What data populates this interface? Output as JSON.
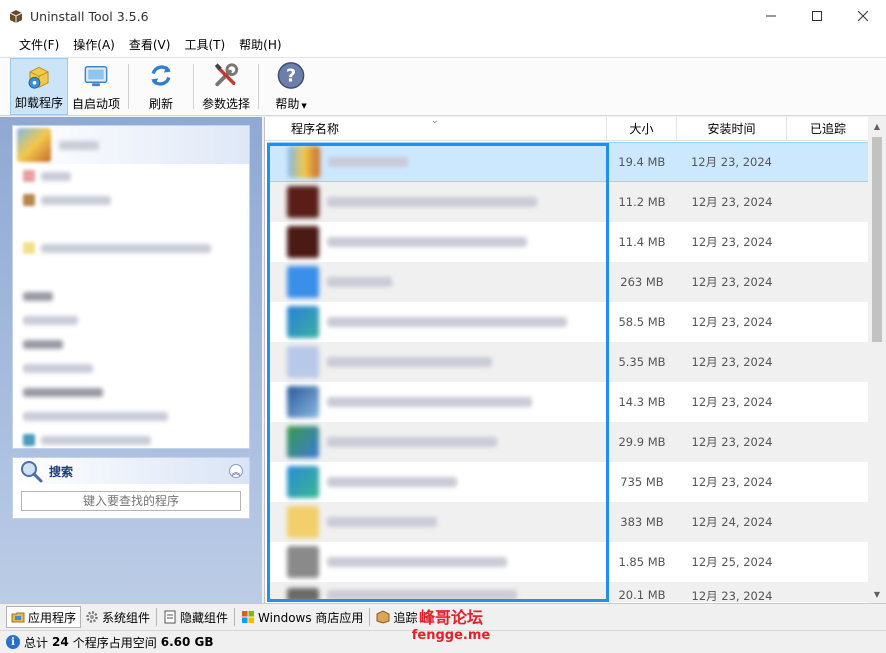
{
  "window": {
    "title": "Uninstall Tool 3.5.6"
  },
  "menu": [
    "文件(F)",
    "操作(A)",
    "查看(V)",
    "工具(T)",
    "帮助(H)"
  ],
  "toolbar": {
    "uninstall": "卸载程序",
    "autostart": "自启动项",
    "refresh": "刷新",
    "settings": "参数选择",
    "help": "帮助"
  },
  "search": {
    "title": "搜索",
    "placeholder": "键入要查找的程序"
  },
  "list": {
    "columns": {
      "name": "程序名称",
      "size": "大小",
      "date": "安装时间",
      "traced": "已追踪"
    },
    "rows": [
      {
        "size": "19.4 MB",
        "date": "12月 23, 2024"
      },
      {
        "size": "11.2 MB",
        "date": "12月 23, 2024"
      },
      {
        "size": "11.4 MB",
        "date": "12月 23, 2024"
      },
      {
        "size": "263 MB",
        "date": "12月 23, 2024"
      },
      {
        "size": "58.5 MB",
        "date": "12月 23, 2024"
      },
      {
        "size": "5.35 MB",
        "date": "12月 23, 2024"
      },
      {
        "size": "14.3 MB",
        "date": "12月 23, 2024"
      },
      {
        "size": "29.9 MB",
        "date": "12月 23, 2024"
      },
      {
        "size": "735 MB",
        "date": "12月 23, 2024"
      },
      {
        "size": "383 MB",
        "date": "12月 24, 2024"
      },
      {
        "size": "1.85 MB",
        "date": "12月 25, 2024"
      },
      {
        "size": "20.1 MB",
        "date": "12月 23, 2024"
      }
    ]
  },
  "tabs": {
    "apps": "应用程序",
    "system": "系统组件",
    "hidden": "隐藏组件",
    "store": "Windows 商店应用",
    "traced": "追踪"
  },
  "status": {
    "prefix": "总计",
    "count": "24",
    "middle": "个程序占用空间",
    "total": "6.60 GB"
  },
  "watermark": {
    "line1": "峰哥论坛",
    "line2": "fengge.me"
  },
  "colors": {
    "accent": "#1e90f0",
    "selection": "#cce8ff"
  }
}
